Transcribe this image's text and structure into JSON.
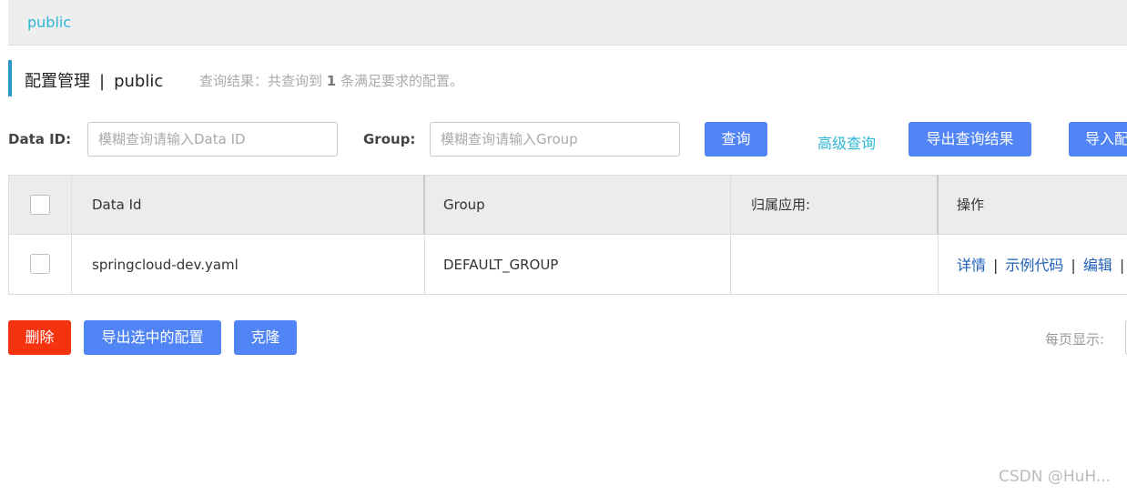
{
  "namespace_bar": {
    "tab_label": "public"
  },
  "header": {
    "title": "配置管理",
    "separator": "|",
    "namespace": "public",
    "result_prefix": "查询结果：共查询到",
    "result_count": "1",
    "result_suffix": "条满足要求的配置。"
  },
  "search": {
    "data_id_label": "Data ID:",
    "data_id_placeholder": "模糊查询请输入Data ID",
    "group_label": "Group:",
    "group_placeholder": "模糊查询请输入Group",
    "query_button": "查询",
    "advanced_query": "高级查询",
    "export_results_button": "导出查询结果",
    "import_button": "导入配置"
  },
  "table": {
    "columns": [
      "Data Id",
      "Group",
      "归属应用:",
      "操作"
    ],
    "rows": [
      {
        "data_id": "springcloud-dev.yaml",
        "group": "DEFAULT_GROUP",
        "app": "",
        "actions": [
          "详情",
          "示例代码",
          "编辑"
        ]
      }
    ]
  },
  "bottom": {
    "delete_button": "删除",
    "export_selected_button": "导出选中的配置",
    "clone_button": "克隆",
    "per_page_label": "每页显示:"
  },
  "watermark": "CSDN @HuH...",
  "colors": {
    "primary_blue": "#5184f5",
    "danger_red": "#f5330f",
    "link_teal": "#2db7d6",
    "accent_bar": "#2d96c8",
    "action_link": "#2160b8"
  }
}
